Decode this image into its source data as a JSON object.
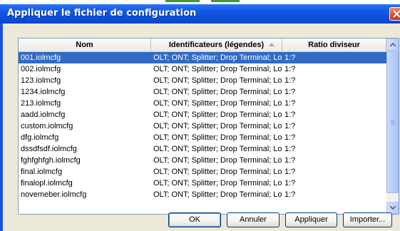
{
  "dialog": {
    "title": "Appliquer le fichier de configuration"
  },
  "table": {
    "columns": [
      "Nom",
      "Identificateurs (légendes)",
      "Ratio diviseur"
    ],
    "sorted_column": 1,
    "selected_row": 0,
    "rows": [
      [
        "001.iolmcfg",
        "OLT; ONT; Splitter; Drop Terminal; Local",
        "1:?"
      ],
      [
        "002.iolmcfg",
        "OLT; ONT; Splitter; Drop Terminal; Local",
        "1:?"
      ],
      [
        "123.iolmcfg",
        "OLT; ONT; Splitter; Drop Terminal; Local",
        "1:?"
      ],
      [
        "1234.iolmcfg",
        "OLT; ONT; Splitter; Drop Terminal; Local",
        "1:?"
      ],
      [
        "213.iolmcfg",
        "OLT; ONT; Splitter; Drop Terminal; Local",
        "1:?"
      ],
      [
        "aadd.iolmcfg",
        "OLT; ONT; Splitter; Drop Terminal; Local",
        "1:?"
      ],
      [
        "custom.iolmcfg",
        "OLT; ONT; Splitter; Drop Terminal; Local",
        "1:?"
      ],
      [
        "dfg.iolmcfg",
        "OLT; ONT; Splitter; Drop Terminal; Local",
        "1:?"
      ],
      [
        "dssdfsdf.iolmcfg",
        "OLT; ONT; Splitter; Drop Terminal; Local",
        "1:?"
      ],
      [
        "fghfghfgh.iolmcfg",
        "OLT; ONT; Splitter; Drop Terminal; Local",
        "1:?"
      ],
      [
        "final.iolmcfg",
        "OLT; ONT; Splitter; Drop Terminal; Local",
        "1:?"
      ],
      [
        "finalopl.iolmcfg",
        "OLT; ONT; Splitter; Drop Terminal; Local",
        "1:?"
      ],
      [
        "novemeber.iolmcfg",
        "OLT; ONT; Splitter; Drop Terminal; Local",
        "1:?"
      ]
    ]
  },
  "buttons": {
    "ok": "OK",
    "cancel": "Annuler",
    "apply": "Appliquer",
    "import": "Importer..."
  },
  "icons": {
    "close": "close-icon",
    "sort": "sort-ascending-icon",
    "scroll_up": "chevron-up-icon",
    "scroll_down": "chevron-down-icon"
  },
  "colors": {
    "titlebar": "#0d4fd8",
    "selection": "#316ac5",
    "close_button": "#de4b26"
  }
}
